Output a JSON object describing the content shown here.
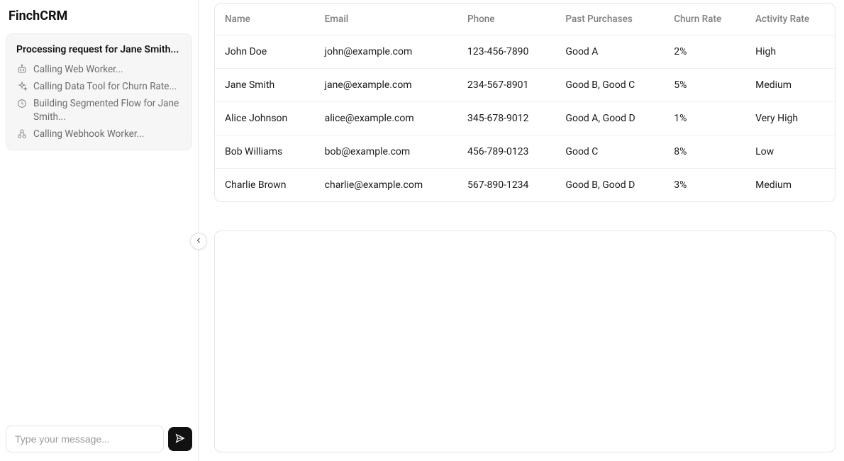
{
  "app": {
    "title": "FinchCRM"
  },
  "processing": {
    "title": "Processing request for Jane Smith...",
    "steps": [
      {
        "icon": "bot-icon",
        "label": "Calling Web Worker..."
      },
      {
        "icon": "sparkle-icon",
        "label": "Calling Data Tool for Churn Rate..."
      },
      {
        "icon": "clock-icon",
        "label": "Building Segmented Flow for Jane Smith..."
      },
      {
        "icon": "webhook-icon",
        "label": "Calling Webhook Worker..."
      }
    ]
  },
  "composer": {
    "placeholder": "Type your message..."
  },
  "table": {
    "columns": [
      "Name",
      "Email",
      "Phone",
      "Past Purchases",
      "Churn Rate",
      "Activity Rate"
    ],
    "rows": [
      {
        "name": "John Doe",
        "email": "john@example.com",
        "phone": "123-456-7890",
        "purchases": "Good A",
        "churn": "2%",
        "activity": "High"
      },
      {
        "name": "Jane Smith",
        "email": "jane@example.com",
        "phone": "234-567-8901",
        "purchases": "Good B, Good C",
        "churn": "5%",
        "activity": "Medium"
      },
      {
        "name": "Alice Johnson",
        "email": "alice@example.com",
        "phone": "345-678-9012",
        "purchases": "Good A, Good D",
        "churn": "1%",
        "activity": "Very High"
      },
      {
        "name": "Bob Williams",
        "email": "bob@example.com",
        "phone": "456-789-0123",
        "purchases": "Good C",
        "churn": "8%",
        "activity": "Low"
      },
      {
        "name": "Charlie Brown",
        "email": "charlie@example.com",
        "phone": "567-890-1234",
        "purchases": "Good B, Good D",
        "churn": "3%",
        "activity": "Medium"
      }
    ]
  }
}
